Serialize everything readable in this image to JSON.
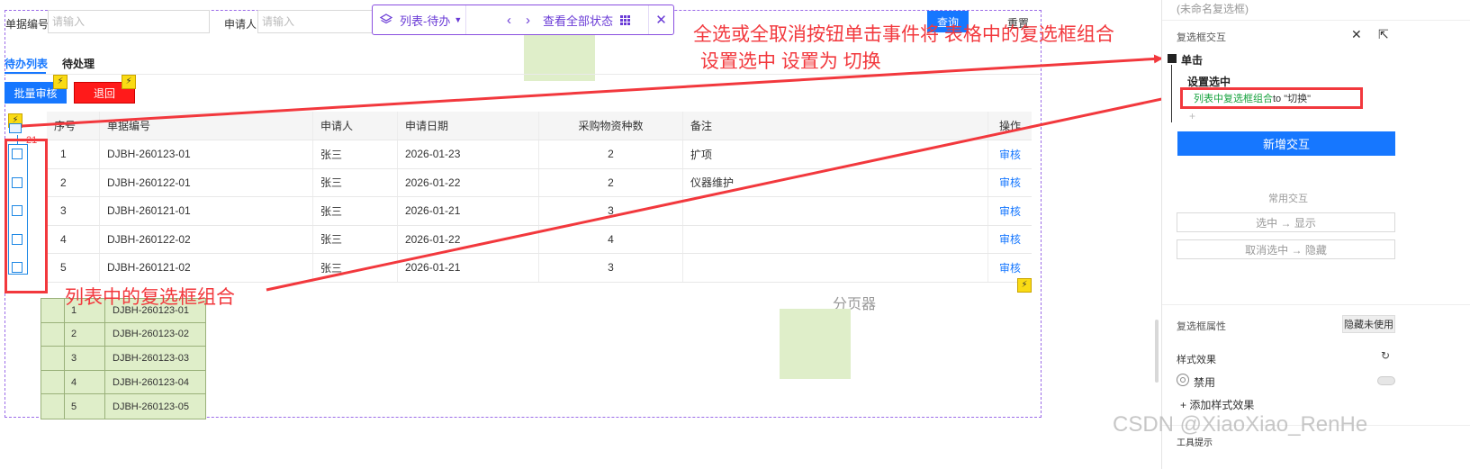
{
  "search": {
    "doc_no_label": "单据编号:",
    "doc_no_placeholder": "请输入",
    "applicant_label": "申请人:",
    "applicant_placeholder": "请输入",
    "query_label": "查询",
    "reset_label": "重置"
  },
  "state_bar": {
    "state_name": "列表-待办",
    "view_all": "查看全部状态"
  },
  "tabs": [
    "待办列表",
    "待处理"
  ],
  "toolbar": {
    "batch_review": "批量审核",
    "reject": "退回"
  },
  "table": {
    "header_count": "21",
    "columns": [
      "序号",
      "单据编号",
      "申请人",
      "申请日期",
      "采购物资种数",
      "备注",
      "操作"
    ],
    "rows": [
      {
        "seq": "1",
        "doc": "DJBH-260123-01",
        "applicant": "张三",
        "date": "2026-01-23",
        "count": "2",
        "note": "扩项",
        "action": "审核"
      },
      {
        "seq": "2",
        "doc": "DJBH-260122-01",
        "applicant": "张三",
        "date": "2026-01-22",
        "count": "2",
        "note": "仪器维护",
        "action": "审核"
      },
      {
        "seq": "3",
        "doc": "DJBH-260121-01",
        "applicant": "张三",
        "date": "2026-01-21",
        "count": "3",
        "note": "",
        "action": "审核"
      },
      {
        "seq": "4",
        "doc": "DJBH-260122-02",
        "applicant": "张三",
        "date": "2026-01-22",
        "count": "4",
        "note": "",
        "action": "审核"
      },
      {
        "seq": "5",
        "doc": "DJBH-260121-02",
        "applicant": "张三",
        "date": "2026-01-21",
        "count": "3",
        "note": "",
        "action": "审核"
      }
    ]
  },
  "pager_label": "分页器",
  "green_list": [
    {
      "seq": "1",
      "doc": "DJBH-260123-01"
    },
    {
      "seq": "2",
      "doc": "DJBH-260123-02"
    },
    {
      "seq": "3",
      "doc": "DJBH-260123-03"
    },
    {
      "seq": "4",
      "doc": "DJBH-260123-04"
    },
    {
      "seq": "5",
      "doc": "DJBH-260123-05"
    }
  ],
  "annotations": {
    "top_line1": "全选或全取消按钮单击事件将  表格中的复选框组合",
    "top_line2": "设置选中  设置为  切换",
    "bottom": "列表中的复选框组合"
  },
  "panel": {
    "component_name": "(未命名复选框)",
    "section_interaction": "复选框交互",
    "event_click": "单击",
    "action_set_checked": "设置选中",
    "action_target": "列表中复选框组合",
    "action_value": " to \"切换\"",
    "add_interaction": "新增交互",
    "common_interaction": "常用交互",
    "common_1": "选中 → 显示",
    "common_2": "取消选中 → 隐藏",
    "section_properties": "复选框属性",
    "hide_unused": "隐藏未使用",
    "style_effects": "样式效果",
    "disabled": "禁用",
    "add_style_effect": "+ 添加样式效果",
    "tooltip": "工具提示"
  },
  "watermark": "CSDN @XiaoXiao_RenHe",
  "colors": {
    "accent_blue": "#1677ff",
    "annotation_red": "#f2383d",
    "state_purple": "#8a4fe0",
    "placeholder_green": "#dfeec9",
    "action_green": "#18a33f"
  }
}
